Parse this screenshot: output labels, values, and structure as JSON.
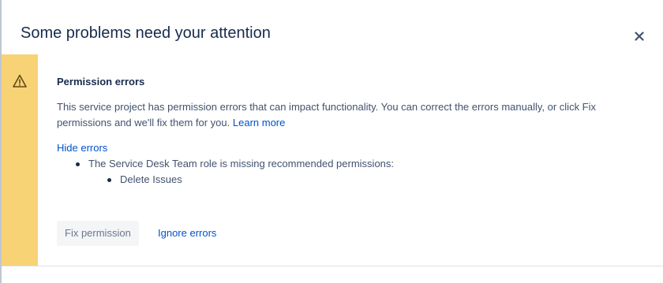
{
  "dialog": {
    "title": "Some problems need your attention",
    "close_icon": "close-icon"
  },
  "warning": {
    "icon": "warning-icon",
    "bar_color": "#f8d376"
  },
  "section": {
    "title": "Permission errors",
    "description": "This service project has permission errors that can impact functionality. You can correct the errors manually, or click Fix permissions and we'll fix them for you.",
    "learn_more_label": "Learn more",
    "hide_errors_label": "Hide errors",
    "errors": [
      {
        "text": "The Service Desk Team role is missing recommended permissions:",
        "sub_items": [
          "Delete Issues"
        ]
      }
    ]
  },
  "actions": {
    "fix_label": "Fix permission",
    "ignore_label": "Ignore errors"
  },
  "colors": {
    "link": "#0052cc",
    "text": "#172b4d",
    "subtle_text": "#42526e"
  }
}
